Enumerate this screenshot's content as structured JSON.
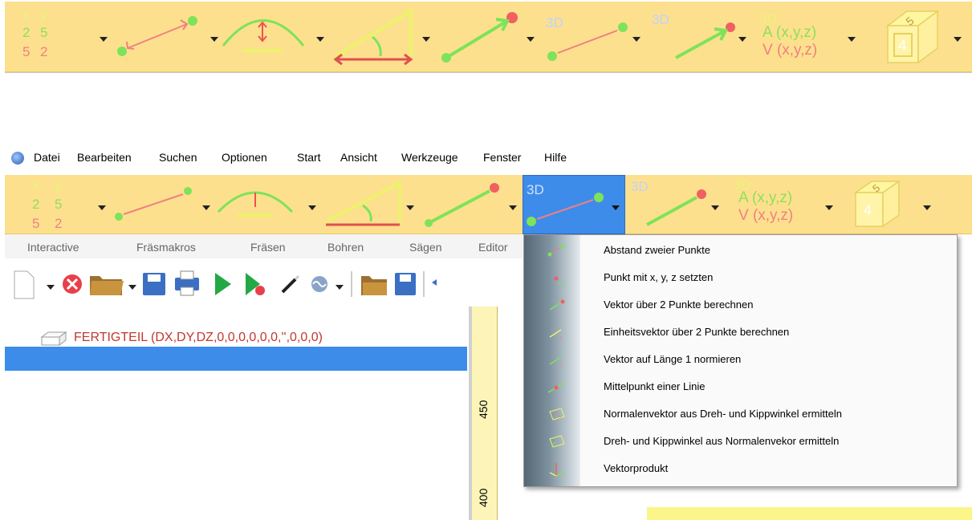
{
  "toolbar_icons": {
    "xy_table": {
      "header": [
        "x",
        "y"
      ],
      "row1": [
        "2",
        "5"
      ],
      "row2": [
        "5",
        "2"
      ]
    },
    "badge_3d": "3D",
    "av_line1": "A (x,y,z)",
    "av_line2": "V (x,y,z)",
    "cube_front": "4",
    "cube_top": "5"
  },
  "menubar": {
    "items": [
      "Datei",
      "Bearbeiten",
      "Suchen",
      "Optionen",
      "Start",
      "Ansicht",
      "Werkzeuge",
      "Fenster",
      "Hilfe"
    ]
  },
  "ribbon_tabs": [
    "Interactive",
    "Fräsmakros",
    "Fräsen",
    "Bohren",
    "Sägen",
    "Editor"
  ],
  "tree": {
    "root_text": "FERTIGTEIL  (DX,DY,DZ,0,0,0,0,0,0,'',0,0,0)"
  },
  "ruler": {
    "labels": [
      "450",
      "400"
    ]
  },
  "dropdown": {
    "items": [
      "Abstand zweier Punkte",
      "Punkt mit x, y, z setzten",
      "Vektor über 2 Punkte berechnen",
      "Einheitsvektor über 2 Punkte berechnen",
      "Vektor auf Länge 1 normieren",
      "Mittelpunkt einer Linie",
      "Normalenvektor aus Dreh- und Kippwinkel ermitteln",
      "Dreh- und Kippwinkel aus Normalenvekor ermitteln",
      "Vektorprodukt"
    ]
  },
  "colors": {
    "toolbar_bg": "#fde08e",
    "selection_blue": "#3d8cea",
    "accent_red": "#f08080",
    "accent_green": "#6fdc45"
  }
}
